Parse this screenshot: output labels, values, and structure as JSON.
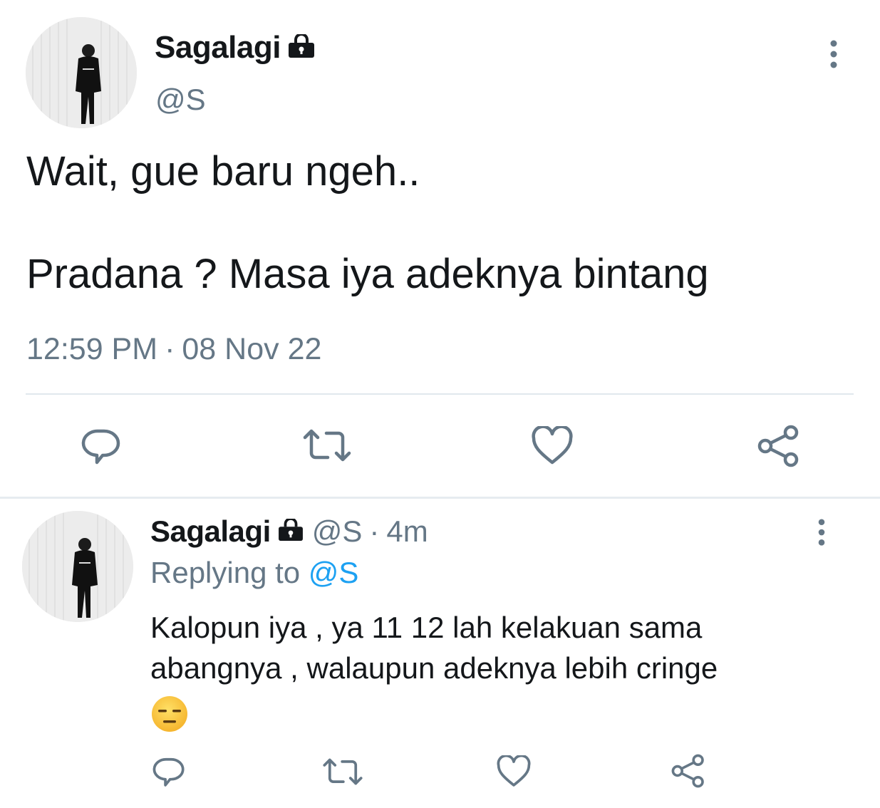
{
  "main_tweet": {
    "display_name": "Sagalagi",
    "handle": "@S",
    "text_line_1": "Wait, gue baru ngeh..",
    "text_line_2": "Pradana ? Masa iya adeknya bintang",
    "time": "12:59 PM",
    "date": "08 Nov 22",
    "separator": "·"
  },
  "reply_tweet": {
    "display_name": "Sagalagi",
    "handle": "@S",
    "separator": "·",
    "age": "4m",
    "replying_label": "Replying to",
    "replying_handle": "@S",
    "text_line_1": "Kalopun iya , ya 11 12 lah kelakuan sama",
    "text_line_2": "abangnya , walaupun adeknya lebih cringe",
    "emoji": "expressionless-face"
  },
  "icons": {
    "reply": "reply-icon",
    "retweet": "retweet-icon",
    "like": "heart-icon",
    "share": "share-icon",
    "more": "more-vertical-icon",
    "protected": "lock-icon"
  },
  "colors": {
    "text": "#14171a",
    "muted": "#657786",
    "link": "#1da1f2",
    "divider": "#e1e8ed"
  }
}
